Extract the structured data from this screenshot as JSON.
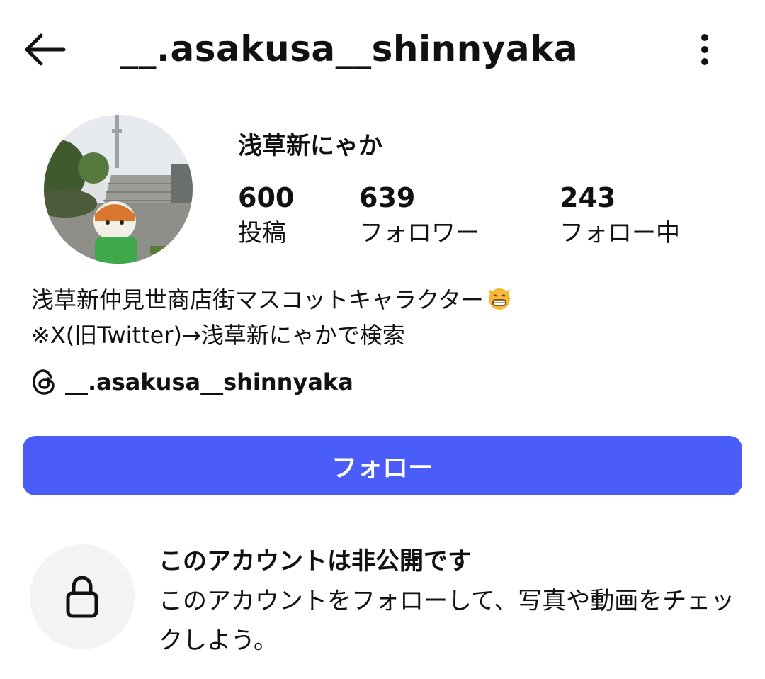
{
  "header": {
    "username": "__.asakusa__shinnyaka",
    "back_icon": "arrow-left-icon",
    "more_icon": "more-vertical-icon"
  },
  "profile": {
    "display_name": "浅草新にゃか",
    "stats": [
      {
        "value": "600",
        "label": "投稿"
      },
      {
        "value": "639",
        "label": "フォロワー"
      },
      {
        "value": "243",
        "label": "フォロー中"
      }
    ],
    "bio_line1": "浅草新仲見世商店街マスコットキャラクター",
    "bio_line2": "※X(旧Twitter)→浅草新にゃかで検索",
    "threads_handle": "__.asakusa__shinnyaka"
  },
  "actions": {
    "follow_label": "フォロー"
  },
  "private_notice": {
    "title": "このアカウントは非公開です",
    "description": "このアカウントをフォローして、写真や動画をチェックしよう。"
  },
  "colors": {
    "accent": "#4a5df9",
    "lock_bg": "#f1f3f5",
    "text": "#111111"
  }
}
